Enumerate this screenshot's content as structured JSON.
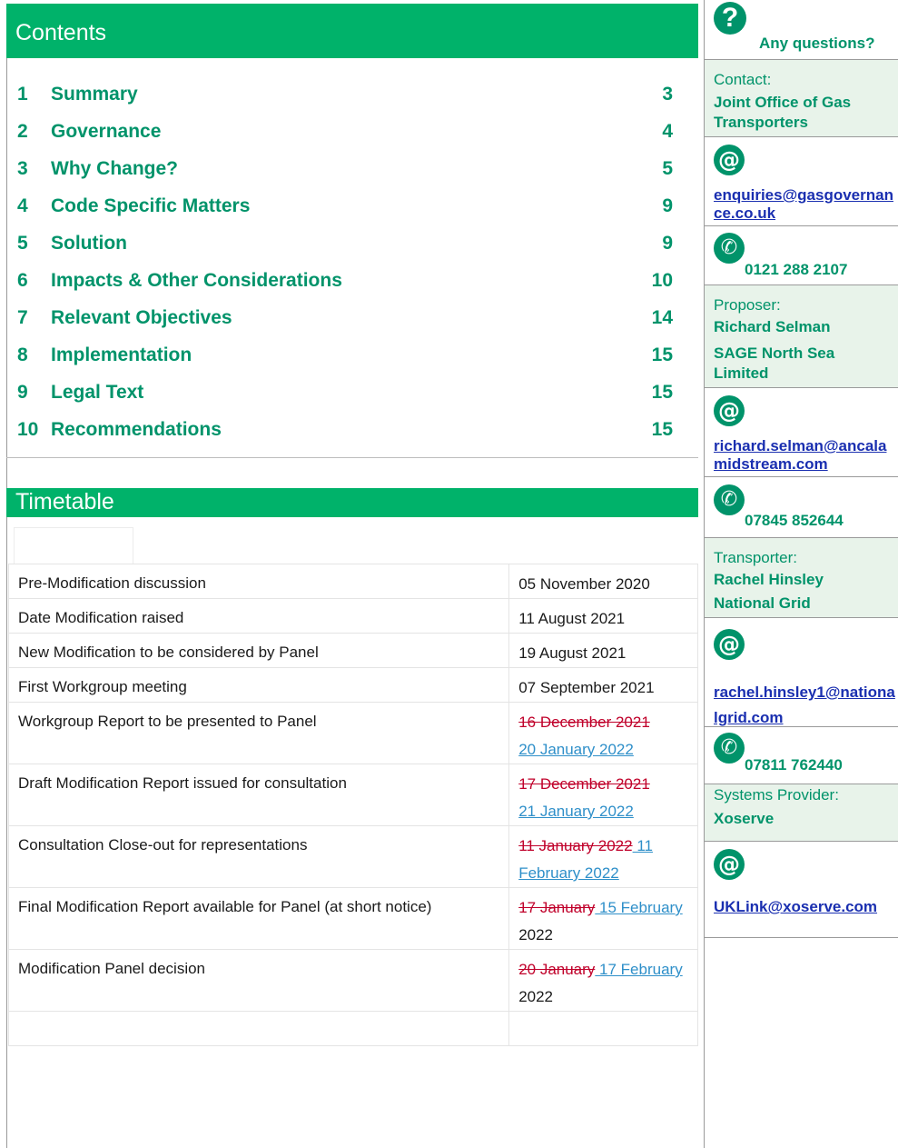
{
  "contents": {
    "header": "Contents",
    "items": [
      {
        "num": "1",
        "label": "Summary",
        "page": "3"
      },
      {
        "num": "2",
        "label": "Governance",
        "page": "4"
      },
      {
        "num": "3",
        "label": "Why Change?",
        "page": "5"
      },
      {
        "num": "4",
        "label": "Code Specific Matters",
        "page": "9"
      },
      {
        "num": "5",
        "label": "Solution",
        "page": "9"
      },
      {
        "num": "6",
        "label": "Impacts & Other Considerations",
        "page": "10"
      },
      {
        "num": "7",
        "label": "Relevant Objectives",
        "page": "14"
      },
      {
        "num": "8",
        "label": "Implementation",
        "page": "15"
      },
      {
        "num": "9",
        "label": "Legal Text",
        "page": "15"
      },
      {
        "num": "10",
        "label": "Recommendations",
        "page": "15"
      }
    ]
  },
  "timetable": {
    "header": "Timetable",
    "rows": [
      {
        "desc": "Pre-Modification discussion",
        "date": "05 November 2020"
      },
      {
        "desc": "Date Modification raised",
        "date": "11 August 2021"
      },
      {
        "desc": "New Modification to be considered by Panel",
        "date": "19 August 2021"
      },
      {
        "desc": "First Workgroup meeting",
        "date": "07 September 2021"
      },
      {
        "desc": "Workgroup Report to be presented to Panel",
        "old": "16 December 2021",
        "new": "20 January 2022"
      },
      {
        "desc": "Draft Modification Report issued for consultation",
        "old": "17 December 2021",
        "new": "21 January 2022"
      },
      {
        "desc": "Consultation Close-out for representations",
        "old": "11 January 2022",
        "new": " 11 February 2022"
      },
      {
        "desc": "Final Modification Report available for Panel (at short notice)",
        "old": "17 January",
        "new": " 15 February ",
        "tail": "2022"
      },
      {
        "desc": "Modification Panel decision",
        "old": "20 January",
        "new": " 17 February ",
        "tail": "2022"
      }
    ]
  },
  "sidebar": {
    "questions": "Any questions?",
    "contact_label": "Contact:",
    "contact_org": "Joint Office of Gas Transporters",
    "contact_email": "enquiries@gasgovernance.co.uk",
    "contact_phone": "0121 288 2107",
    "proposer_label": "Proposer:",
    "proposer_name": "Richard Selman",
    "proposer_org": "SAGE North Sea Limited",
    "proposer_email": "richard.selman@ancalamidstream.com",
    "proposer_phone": "07845 852644",
    "transporter_label": "Transporter:",
    "transporter_name": "Rachel Hinsley",
    "transporter_org": "National Grid",
    "transporter_email": "rachel.hinsley1@nationalgrid.com",
    "transporter_phone": "07811 762440",
    "systems_label": "Systems Provider:",
    "systems_org": "Xoserve",
    "systems_email": "UKLink@xoserve.com"
  },
  "icons": {
    "question": "question-icon",
    "email": "email-icon",
    "phone": "phone-icon"
  },
  "colors": {
    "brand_green": "#00b26a",
    "text_green": "#00936a",
    "link_blue": "#1a2fb0",
    "strike_red": "#c0002a",
    "new_date_blue": "#2e8fc9"
  }
}
